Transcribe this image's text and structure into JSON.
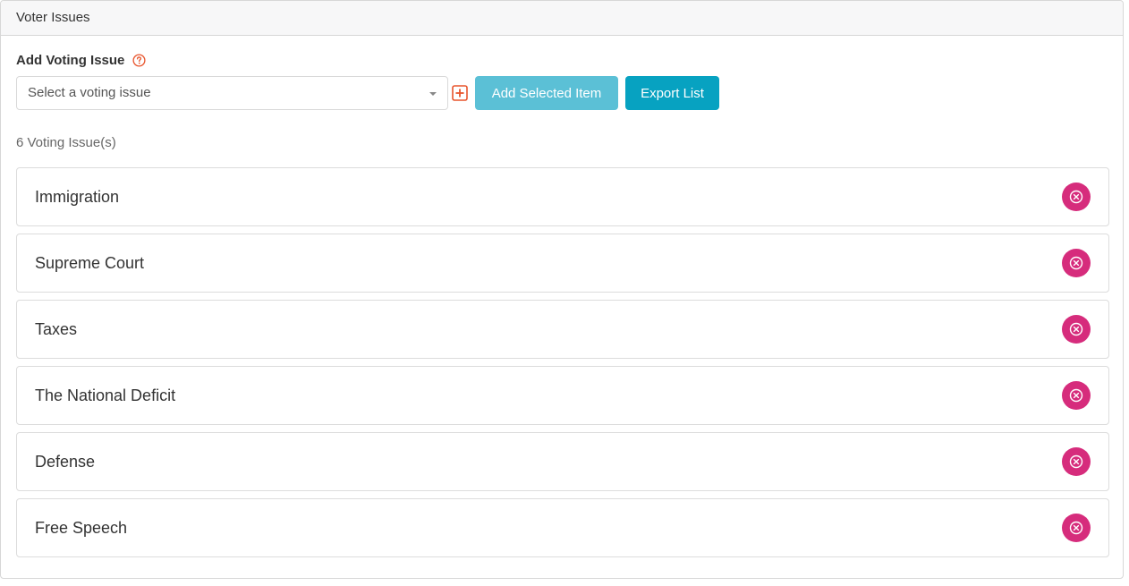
{
  "panel": {
    "title": "Voter Issues"
  },
  "form": {
    "label": "Add Voting Issue",
    "select_placeholder": "Select a voting issue",
    "add_button": "Add Selected Item",
    "export_button": "Export List"
  },
  "count_text": "6 Voting Issue(s)",
  "colors": {
    "accent": "#07a2c1",
    "accent_light": "#5bc0d6",
    "remove": "#d62c7c",
    "help_icon": "#e8552d"
  },
  "icons": {
    "help": "question-circle-icon",
    "add": "plus-square-icon",
    "remove": "close-circle-icon"
  },
  "issues": [
    {
      "label": "Immigration"
    },
    {
      "label": "Supreme Court"
    },
    {
      "label": "Taxes"
    },
    {
      "label": "The National Deficit"
    },
    {
      "label": "Defense"
    },
    {
      "label": "Free Speech"
    }
  ]
}
